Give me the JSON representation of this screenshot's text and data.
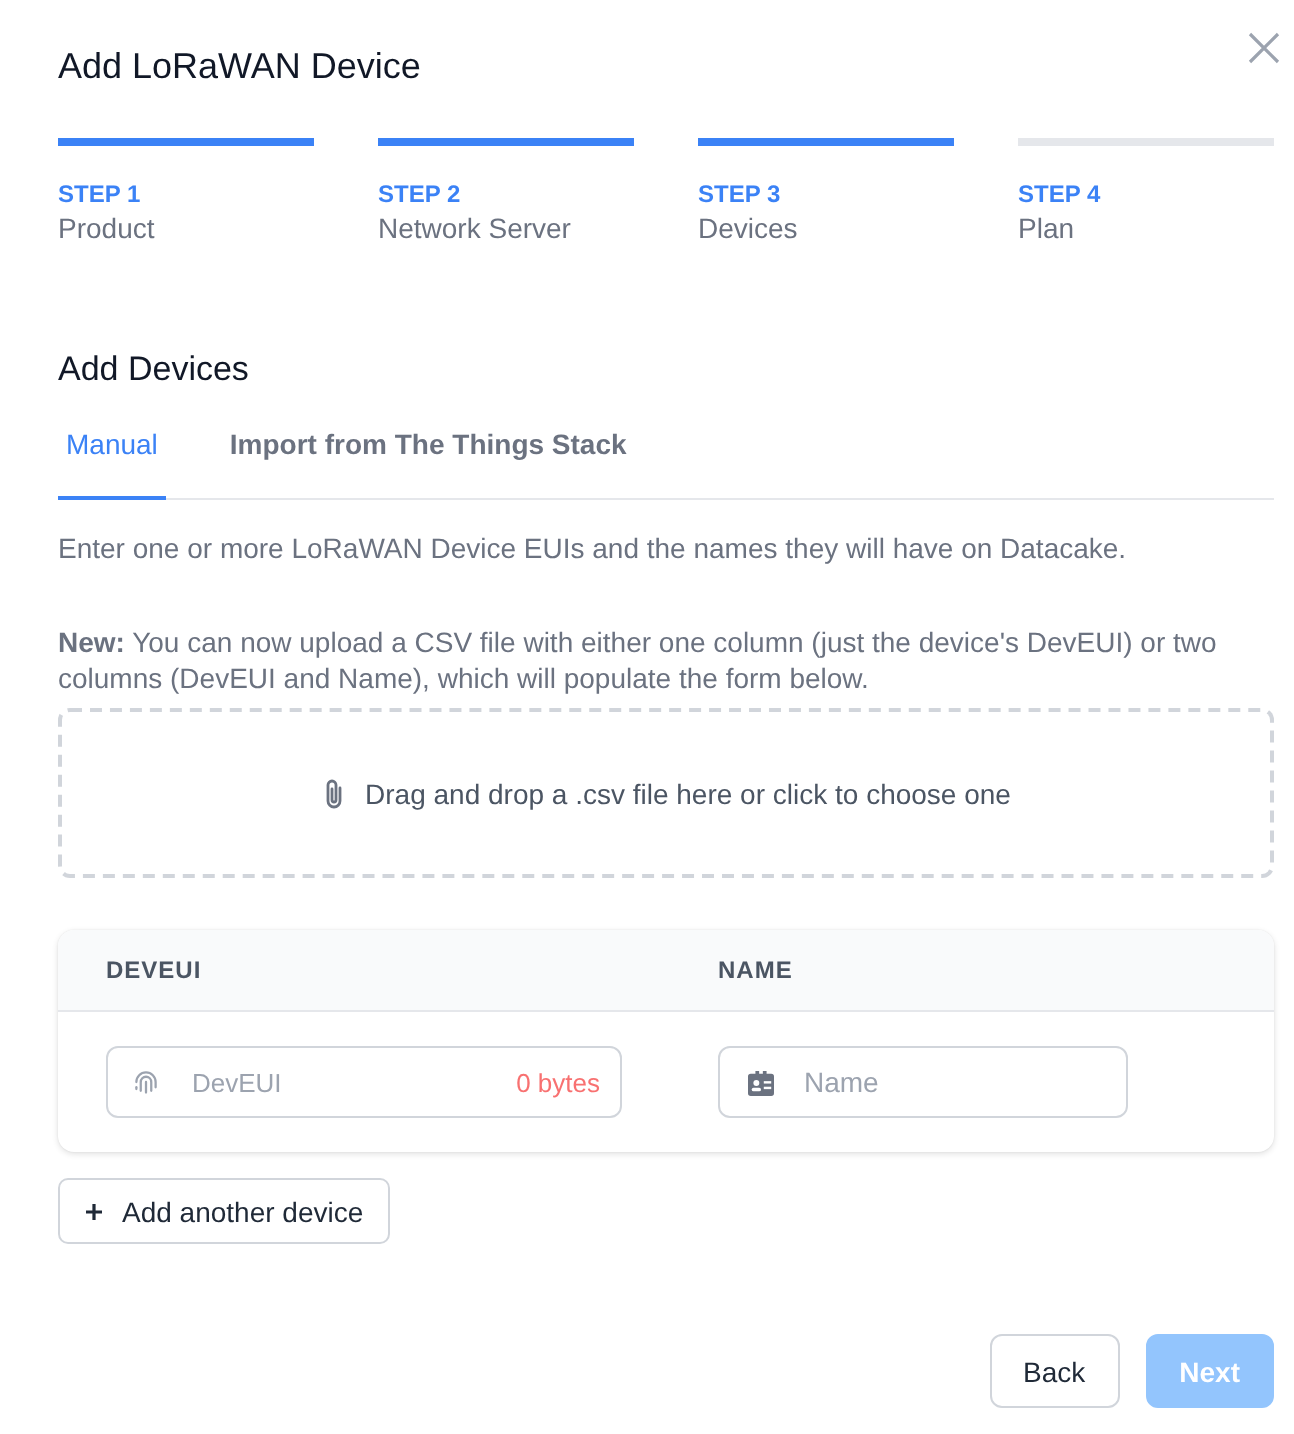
{
  "dialog": {
    "title": "Add LoRaWAN Device"
  },
  "steps": [
    {
      "label": "STEP 1",
      "name": "Product",
      "complete": true
    },
    {
      "label": "STEP 2",
      "name": "Network Server",
      "complete": true
    },
    {
      "label": "STEP 3",
      "name": "Devices",
      "complete": true
    },
    {
      "label": "STEP 4",
      "name": "Plan",
      "complete": false
    }
  ],
  "section": {
    "title": "Add Devices"
  },
  "tabs": [
    {
      "label": "Manual",
      "selected": true
    },
    {
      "label": "Import from The Things Stack",
      "selected": false
    }
  ],
  "intro": "Enter one or more LoRaWAN Device EUIs and the names they will have on Datacake.",
  "notice": "**New:** You can now upload a CSV file with either one column (just the device's DevEUI) or two columns (DevEUI and Name), which will populate the form below.",
  "dropzone": {
    "text": "Drag and drop a .csv file here or click to choose one"
  },
  "table": {
    "columns": [
      "DEVEUI",
      "NAME"
    ],
    "rows": [
      {
        "deveui": {
          "placeholder": "DevEUI",
          "bytes": "0 bytes"
        },
        "name": {
          "placeholder": "Name"
        }
      }
    ]
  },
  "add_button": {
    "label": "Add another device"
  },
  "footer": {
    "buttons": [
      {
        "label": "Back",
        "kind": "secondary",
        "disabled": false
      },
      {
        "label": "Next",
        "kind": "primary",
        "disabled": true
      }
    ]
  }
}
